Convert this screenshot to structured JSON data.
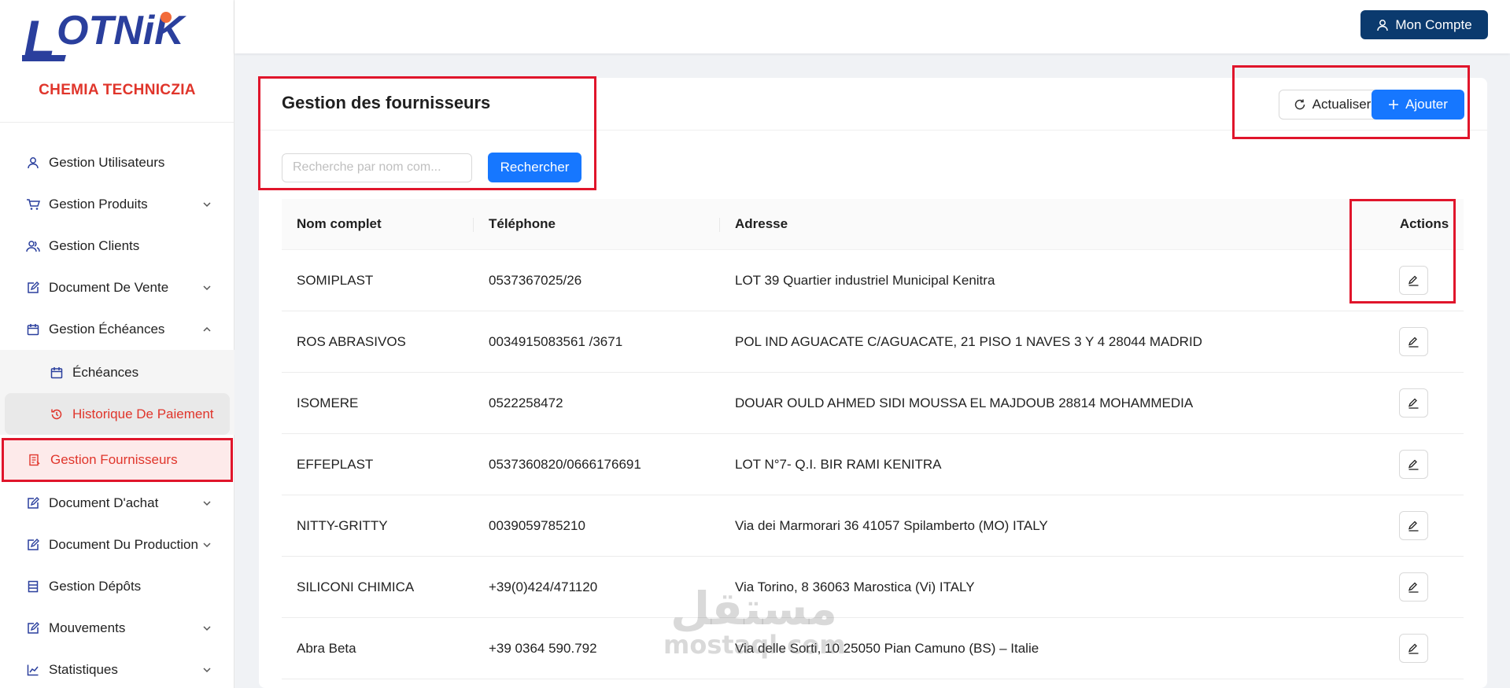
{
  "brand": {
    "logo_text": "LOTNiK",
    "subtitle": "CHEMIA TECHNICZIA",
    "logo_color": "#2a3f9d",
    "accent_color": "#e0352b"
  },
  "header": {
    "account_label": "Mon Compte",
    "account_icon": "user-icon"
  },
  "sidebar": {
    "items": [
      {
        "label": "Gestion Utilisateurs",
        "icon": "user-icon"
      },
      {
        "label": "Gestion Produits",
        "icon": "cart-icon",
        "expandable": true
      },
      {
        "label": "Gestion Clients",
        "icon": "users-icon"
      },
      {
        "label": "Document De Vente",
        "icon": "edit-square-icon",
        "expandable": true
      },
      {
        "label": "Gestion Échéances",
        "icon": "calendar-icon",
        "expanded": true
      },
      {
        "label": "Gestion Fournisseurs",
        "icon": "supplier-icon",
        "active": true
      },
      {
        "label": "Document D'achat",
        "icon": "edit-square-icon",
        "expandable": true
      },
      {
        "label": "Document Du Production",
        "icon": "edit-square-icon",
        "expandable": true
      },
      {
        "label": "Gestion Dépôts",
        "icon": "storage-icon"
      },
      {
        "label": "Mouvements",
        "icon": "edit-square-icon",
        "expandable": true
      },
      {
        "label": "Statistiques",
        "icon": "line-chart-icon",
        "expandable": true
      }
    ],
    "subitems": [
      {
        "label": "Échéances",
        "icon": "calendar-icon"
      },
      {
        "label": "Historique De Paiement",
        "icon": "history-icon",
        "selected": true
      }
    ]
  },
  "page": {
    "title": "Gestion des fournisseurs",
    "refresh_label": "Actualiser",
    "add_label": "Ajouter",
    "search_placeholder": "Recherche par nom com...",
    "search_button": "Rechercher"
  },
  "table": {
    "columns": [
      "Nom complet",
      "Téléphone",
      "Adresse",
      "Actions"
    ],
    "rows": [
      {
        "name": "SOMIPLAST",
        "phone": "0537367025/26",
        "address": "LOT 39 Quartier industriel Municipal Kenitra"
      },
      {
        "name": "ROS ABRASIVOS",
        "phone": "0034915083561 /3671",
        "address": "POL IND AGUACATE C/AGUACATE, 21 PISO 1 NAVES 3 Y 4 28044 MADRID"
      },
      {
        "name": "ISOMERE",
        "phone": "0522258472",
        "address": "DOUAR OULD AHMED SIDI MOUSSA EL MAJDOUB 28814 MOHAMMEDIA"
      },
      {
        "name": "EFFEPLAST",
        "phone": "0537360820/0666176691",
        "address": "LOT N°7- Q.I. BIR RAMI KENITRA"
      },
      {
        "name": "NITTY-GRITTY",
        "phone": "0039059785210",
        "address": "Via dei Marmorari 36 41057 Spilamberto (MO) ITALY"
      },
      {
        "name": "SILICONI CHIMICA",
        "phone": "+39(0)424/471120",
        "address": "Via Torino, 8 36063 Marostica (Vi) ITALY"
      },
      {
        "name": "Abra Beta",
        "phone": "+39 0364 590.792",
        "address": "Via delle Sorti, 10 25050 Pian Camuno (BS) – Italie"
      }
    ]
  },
  "watermark": {
    "arabic": "مستقل",
    "latin": "mostaql.com"
  },
  "colors": {
    "primary": "#1677ff",
    "account_bg": "#0b3a6e",
    "highlight": "#e0152b"
  }
}
